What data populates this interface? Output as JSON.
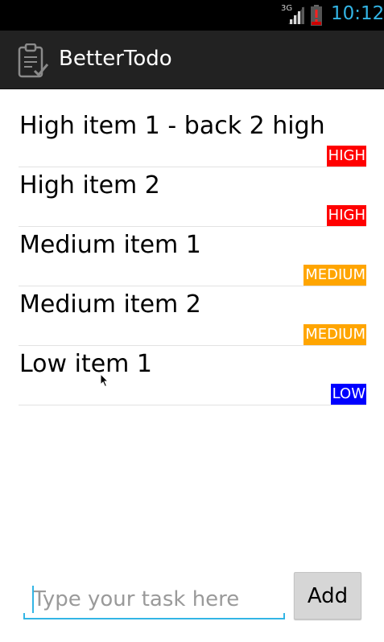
{
  "status_bar": {
    "network_type": "3G",
    "time": "10:12",
    "time_color": "#33b5e5",
    "signal_icon": "signal-icon",
    "battery_icon": "battery-alert-icon"
  },
  "action_bar": {
    "title": "BetterTodo",
    "icon": "clipboard-check-icon"
  },
  "tasks": [
    {
      "text": "High item 1 - back 2 high",
      "priority": "HIGH",
      "color": "#ff0000"
    },
    {
      "text": "High item 2",
      "priority": "HIGH",
      "color": "#ff0000"
    },
    {
      "text": "Medium item 1",
      "priority": "MEDIUM",
      "color": "#ffa500"
    },
    {
      "text": "Medium item 2",
      "priority": "MEDIUM",
      "color": "#ffa500"
    },
    {
      "text": "Low item 1",
      "priority": "LOW",
      "color": "#0000ff"
    }
  ],
  "input": {
    "placeholder": "Type your task here",
    "value": ""
  },
  "add_button": {
    "label": "Add"
  }
}
